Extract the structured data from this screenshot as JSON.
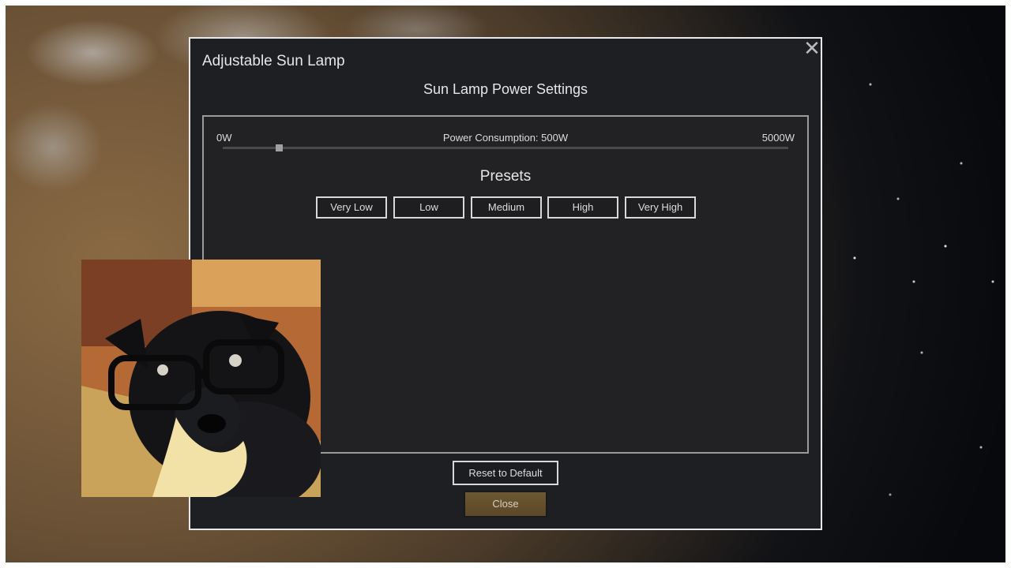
{
  "dialog": {
    "title": "Adjustable Sun Lamp",
    "close_icon": "close-icon"
  },
  "power": {
    "heading": "Sun Lamp Power Settings",
    "min_label": "0W",
    "max_label": "5000W",
    "consumption_label": "Power Consumption: 500W",
    "value_watts": 500,
    "min_watts": 0,
    "max_watts": 5000
  },
  "presets": {
    "heading": "Presets",
    "items": [
      "Very Low",
      "Low",
      "Medium",
      "High",
      "Very High"
    ]
  },
  "buttons": {
    "reset": "Reset to Default",
    "close": "Close"
  },
  "colors": {
    "close_button": "#6e5833"
  }
}
